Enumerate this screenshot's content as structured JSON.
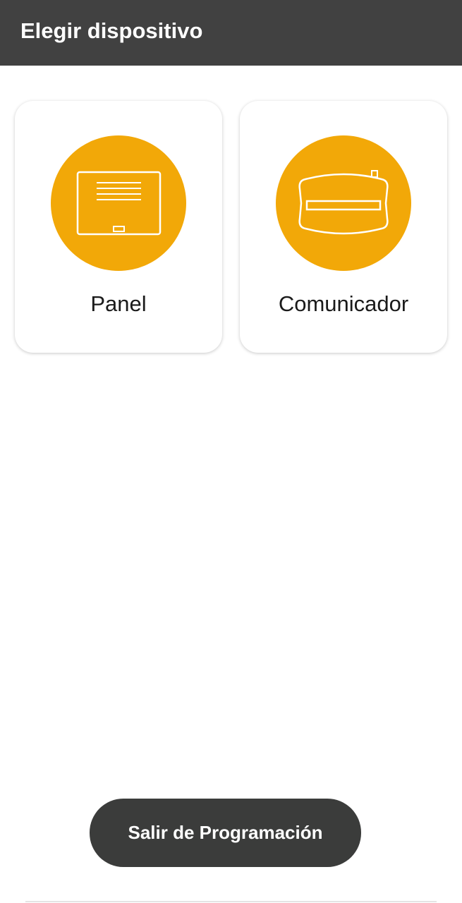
{
  "app_bar": {
    "title": "Elegir dispositivo",
    "background": "#414141"
  },
  "devices": [
    {
      "label": "Panel",
      "icon": "panel-icon"
    },
    {
      "label": "Comunicador",
      "icon": "communicator-icon"
    }
  ],
  "accent_color": "#f2a808",
  "footer": {
    "exit_label": "Salir de Programación"
  }
}
